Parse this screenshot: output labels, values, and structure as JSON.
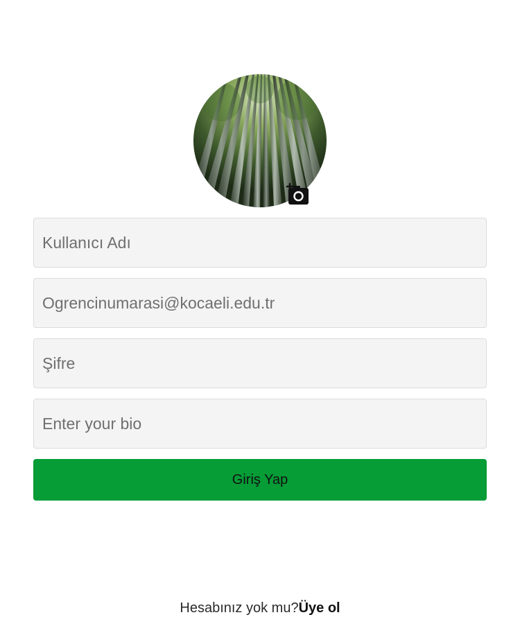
{
  "profile": {
    "avatar_image": "bamboo-forest-photo",
    "add_photo_icon": "add-a-photo-icon"
  },
  "form": {
    "username_placeholder": "Kullanıcı Adı",
    "email_placeholder": "Ogrencinumarasi@kocaeli.edu.tr",
    "password_placeholder": "Şifre",
    "bio_placeholder": "Enter your bio",
    "submit_label": "Giriş Yap"
  },
  "footer": {
    "prompt": "Hesabınız yok mu?",
    "signup_label": "Üye ol"
  },
  "colors": {
    "button_bg": "#069c36",
    "field_bg": "#f4f4f4",
    "field_border": "#dcdcdc"
  }
}
